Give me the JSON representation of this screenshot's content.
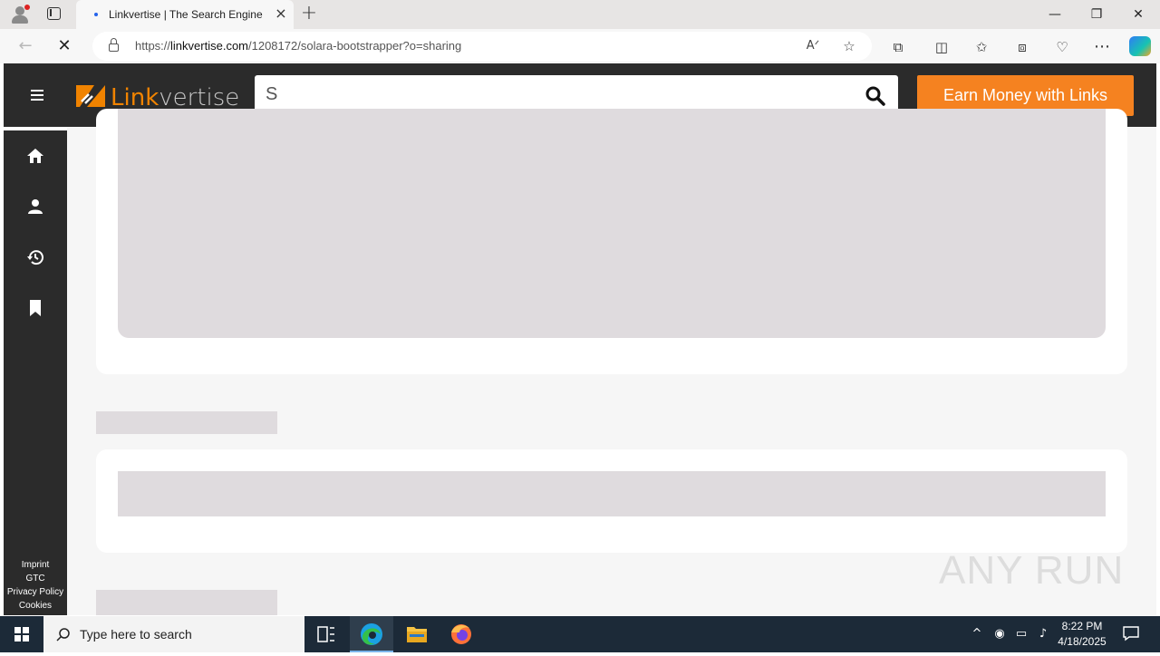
{
  "browser": {
    "tab_title": "Linkvertise | The Search Engine for Everything",
    "url_prefix": "https://",
    "url_domain": "linkvertise.com",
    "url_path": "/1208172/solara-bootstrapper?o=sharing",
    "icons": [
      "profile-icon",
      "tab-actions-icon",
      "close-tab-icon",
      "new-tab-icon",
      "back-icon",
      "stop-icon",
      "lock-icon",
      "read-aloud-icon",
      "favorite-star-icon",
      "extensions-icon",
      "split-screen-icon",
      "favorites-icon",
      "collections-icon",
      "browser-essentials-icon",
      "more-icon",
      "copilot-icon",
      "minimize-icon",
      "restore-icon",
      "close-window-icon"
    ]
  },
  "site": {
    "logo_accent": "Link",
    "logo_rest": "vertise",
    "search_value": "S",
    "earn_button": "Earn Money with Links",
    "accent_color": "#f58220",
    "header_color": "#2b2b2b",
    "sidebar_icons": [
      "home-icon",
      "profile-icon",
      "history-icon",
      "bookmark-icon"
    ],
    "footer_links": [
      "Imprint",
      "GTC",
      "Privacy Policy",
      "Cookies"
    ]
  },
  "watermark": "ANY RUN",
  "taskbar": {
    "search_placeholder": "Type here to search",
    "time": "8:22 PM",
    "date": "4/18/2025",
    "apps": [
      "task-view-icon",
      "edge-icon",
      "file-explorer-icon",
      "firefox-icon"
    ]
  }
}
